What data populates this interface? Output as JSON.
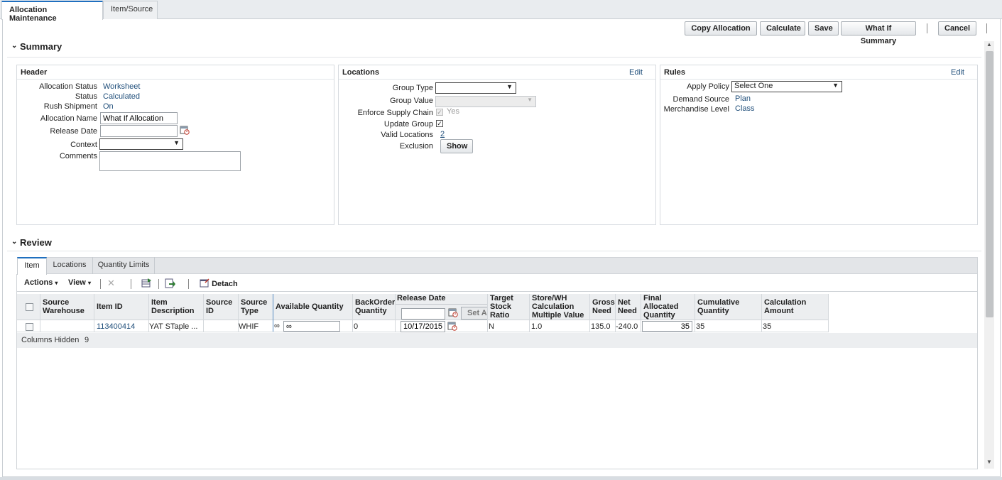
{
  "tabs": {
    "allocation_maintenance": "Allocation Maintenance",
    "item_source": "Item/Source"
  },
  "toolbar": {
    "copy_allocation": "Copy Allocation",
    "calculate": "Calculate",
    "save": "Save",
    "what_if_summary": "What If Summary",
    "cancel": "Cancel"
  },
  "summary": {
    "title": "Summary",
    "header": {
      "title": "Header",
      "allocation_status_label": "Allocation Status",
      "allocation_status_value": "Worksheet",
      "status_label": "Status",
      "status_value": "Calculated",
      "rush_shipment_label": "Rush Shipment",
      "rush_shipment_value": "On",
      "allocation_name_label": "Allocation Name",
      "allocation_name_value": "What If Allocation",
      "release_date_label": "Release Date",
      "release_date_value": "",
      "context_label": "Context",
      "context_value": "",
      "comments_label": "Comments",
      "comments_value": ""
    },
    "locations": {
      "title": "Locations",
      "edit": "Edit",
      "group_type_label": "Group Type",
      "group_type_value": "",
      "group_value_label": "Group Value",
      "group_value_value": "",
      "enforce_supply_chain_label": "Enforce Supply Chain",
      "enforce_supply_chain_value": "Yes",
      "update_group_label": "Update Group",
      "valid_locations_label": "Valid Locations",
      "valid_locations_value": "2",
      "exclusion_label": "Exclusion",
      "show_button": "Show"
    },
    "rules": {
      "title": "Rules",
      "edit": "Edit",
      "apply_policy_label": "Apply Policy",
      "apply_policy_value": "Select One",
      "demand_source_label": "Demand Source",
      "demand_source_value": "Plan",
      "merchandise_level_label": "Merchandise Level",
      "merchandise_level_value": "Class"
    }
  },
  "review": {
    "title": "Review",
    "tabs": {
      "item": "Item",
      "locations": "Locations",
      "quantity_limits": "Quantity Limits"
    },
    "actions": "Actions",
    "view": "View",
    "detach": "Detach",
    "set_all": "Set Al",
    "columns": {
      "source_warehouse": [
        "Source",
        "Warehouse"
      ],
      "item_id": "Item ID",
      "item_description": [
        "Item",
        "Description"
      ],
      "source_id": [
        "Source",
        "ID"
      ],
      "source_type": [
        "Source",
        "Type"
      ],
      "available_quantity": "Available Quantity",
      "backorder_quantity": [
        "BackOrder",
        "Quantity"
      ],
      "release_date": "Release Date",
      "target_stock_ratio": [
        "Target",
        "Stock",
        "Ratio"
      ],
      "store_wh_calc": [
        "Store/WH",
        "Calculation",
        "Multiple Value"
      ],
      "gross_need": [
        "Gross",
        "Need"
      ],
      "net_need": [
        "Net",
        "Need"
      ],
      "final_allocated_quantity": [
        "Final",
        "Allocated",
        "Quantity"
      ],
      "cumulative_quantity": [
        "Cumulative",
        "Quantity"
      ],
      "calculation_amount": [
        "Calculation",
        "Amount"
      ]
    },
    "row": {
      "source_warehouse": "",
      "item_id": "113400414",
      "item_description": "YAT STaple ...",
      "source_id": "",
      "source_type": "WHIF",
      "available_quantity_symbol": "∞",
      "available_quantity_input": "∞",
      "backorder_quantity": "0",
      "release_date": "10/17/2015",
      "target_stock_ratio": "N",
      "store_wh_calc": "1.0",
      "gross_need": "135.0",
      "net_need": "-240.0",
      "final_allocated_quantity": "35",
      "cumulative_quantity": "35",
      "calculation_amount": "35"
    },
    "columns_hidden_label": "Columns Hidden",
    "columns_hidden_value": "9"
  }
}
